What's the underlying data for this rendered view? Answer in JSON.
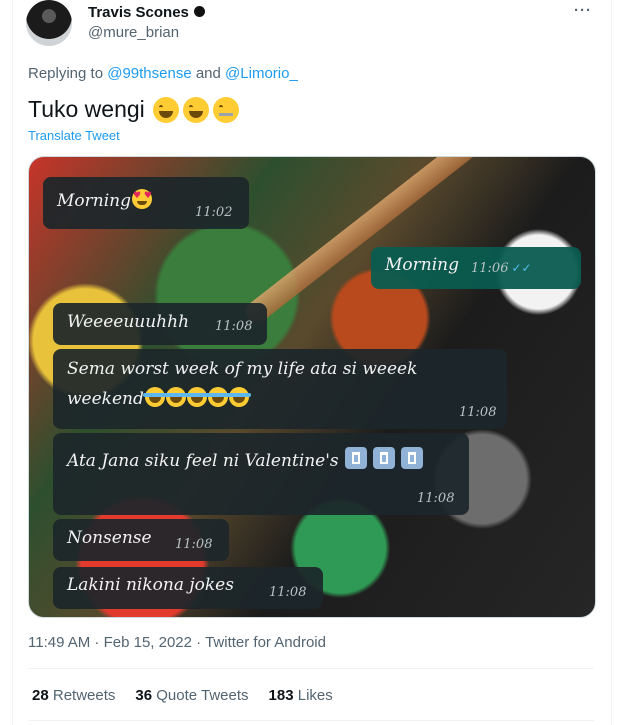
{
  "author": {
    "display_name": "Travis Scones",
    "handle": "@mure_brian"
  },
  "reply": {
    "prefix": "Replying to",
    "mention_1": "@99thsense",
    "connector": "and",
    "mention_2": "@Limorio_"
  },
  "tweet": {
    "text": "Tuko wengi",
    "emojis": [
      "face-with-tears-of-joy",
      "face-with-tears-of-joy",
      "zipper-mouth-face"
    ],
    "translate_label": "Translate Tweet"
  },
  "media": {
    "messages": [
      {
        "text": "Morning",
        "time": "11:02",
        "direction": "in"
      },
      {
        "text": "Morning",
        "time": "11:06",
        "direction": "out"
      },
      {
        "text": "Weeeeuuuhhh",
        "time": "11:08",
        "direction": "in"
      },
      {
        "text_line1": "Sema worst week of my life ata si weeek",
        "text_line2": "weekend",
        "time": "11:08",
        "direction": "in"
      },
      {
        "text": "Ata Jana siku feel ni Valentine's",
        "time": "11:08",
        "direction": "in"
      },
      {
        "text": "Nonsense",
        "time": "11:08",
        "direction": "in"
      },
      {
        "text": "Lakini nikona jokes",
        "time": "11:08",
        "direction": "in"
      }
    ]
  },
  "meta": {
    "timestamp": "11:49 AM · Feb 15, 2022",
    "separator": "·",
    "client": "Twitter for Android"
  },
  "stats": {
    "retweets_count": "28",
    "retweets_label": "Retweets",
    "quotes_count": "36",
    "quotes_label": "Quote Tweets",
    "likes_count": "183",
    "likes_label": "Likes"
  },
  "menu": {
    "more_label": "···"
  }
}
